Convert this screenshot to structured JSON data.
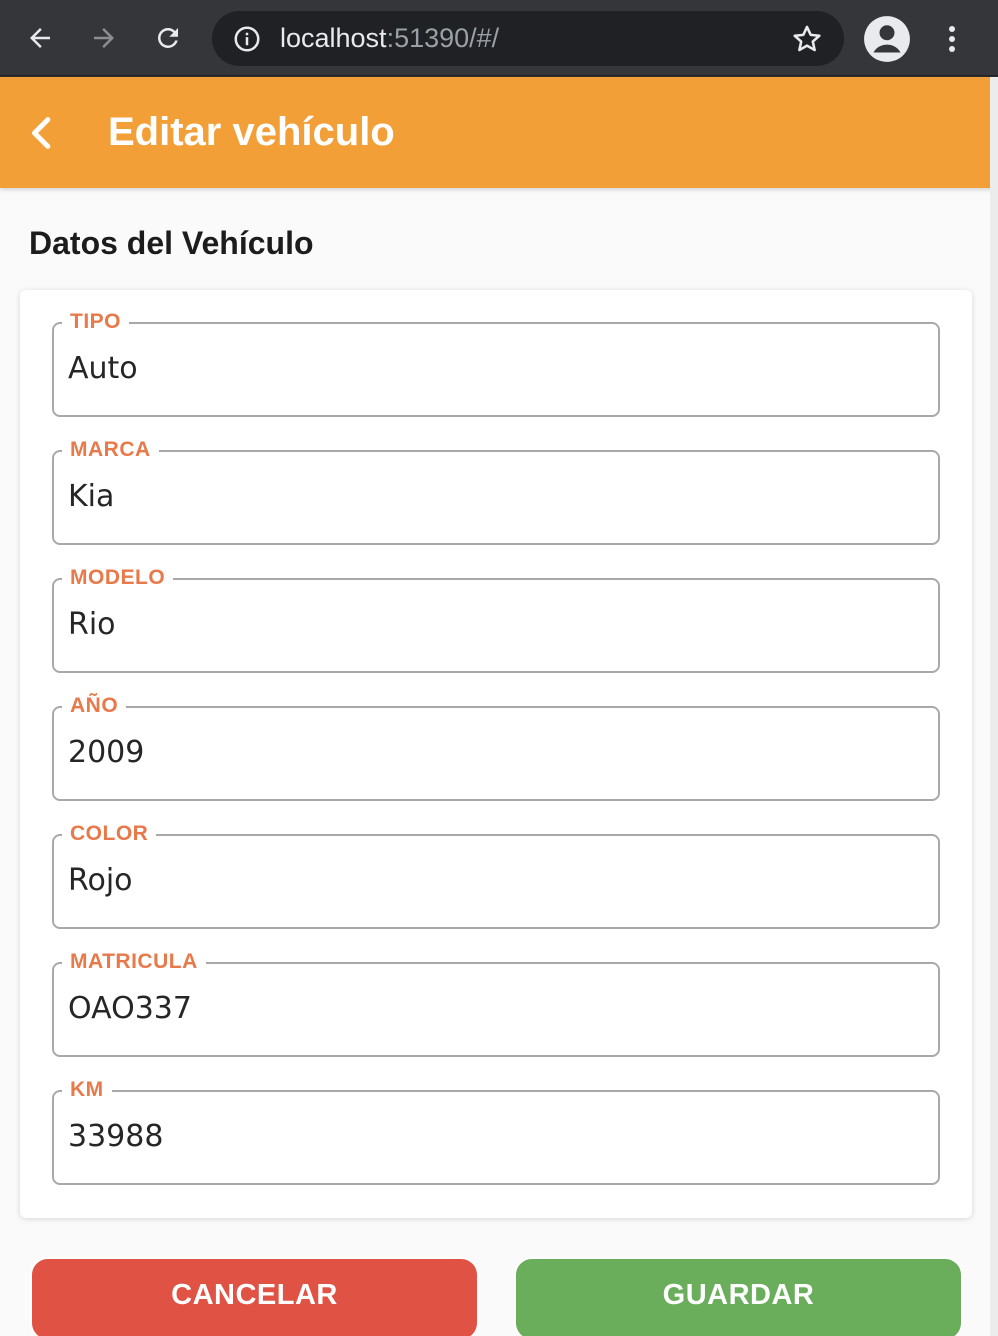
{
  "browser": {
    "url_host": "localhost",
    "url_rest": ":51390/#/",
    "icons": [
      "back-arrow-icon",
      "forward-arrow-icon",
      "reload-icon",
      "info-icon",
      "star-icon",
      "account-icon",
      "kebab-menu-icon"
    ]
  },
  "app_bar": {
    "title": "Editar vehículo",
    "back_icon": "chevron-left-icon",
    "color": "#f29f38"
  },
  "section_title": "Datos del Vehículo",
  "fields": [
    {
      "label": "TIPO",
      "value": "Auto"
    },
    {
      "label": "MARCA",
      "value": "Kia"
    },
    {
      "label": "MODELO",
      "value": "Rio"
    },
    {
      "label": "AÑO",
      "value": "2009"
    },
    {
      "label": "COLOR",
      "value": "Rojo"
    },
    {
      "label": "MATRICULA",
      "value": "OAO337"
    },
    {
      "label": "KM",
      "value": "33988"
    }
  ],
  "colors": {
    "label": "#e8794a",
    "cancel": "#e05344",
    "save": "#6aae5c"
  },
  "buttons": {
    "cancel_label": "CANCELAR",
    "save_label": "GUARDAR"
  }
}
